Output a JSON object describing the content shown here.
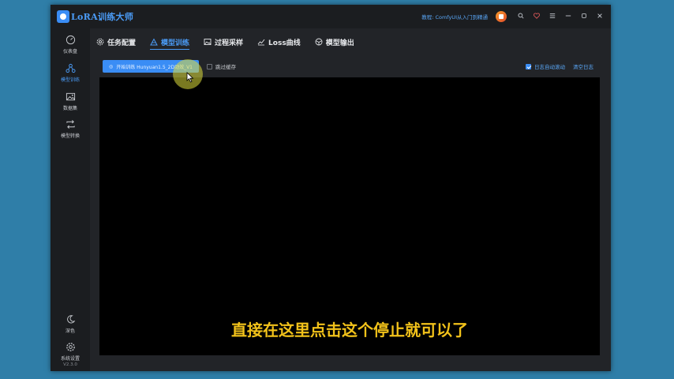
{
  "app": {
    "logo_text": "LoRA训练大师",
    "tutorial_link": "教程: ComfyUI从入门到精通"
  },
  "titlebar_icons": [
    "search-icon",
    "heart-icon",
    "menu-icon",
    "minimize-icon",
    "maximize-icon",
    "close-icon"
  ],
  "sidebar": {
    "items": [
      {
        "label": "仪表盘",
        "icon": "gauge-icon"
      },
      {
        "label": "模型训练",
        "icon": "train-icon",
        "active": true
      },
      {
        "label": "数据集",
        "icon": "image-icon"
      },
      {
        "label": "模型转换",
        "icon": "convert-icon"
      }
    ],
    "theme_label": "深色",
    "settings_label": "系统设置",
    "version": "V2.3.0"
  },
  "tabs": [
    {
      "label": "任务配置",
      "icon": "gear-icon"
    },
    {
      "label": "模型训练",
      "icon": "train-icon",
      "active": true
    },
    {
      "label": "过程采样",
      "icon": "image-icon"
    },
    {
      "label": "Loss曲线",
      "icon": "chart-icon"
    },
    {
      "label": "模型输出",
      "icon": "box-icon"
    }
  ],
  "toolbar": {
    "start_button": "开始训练 Hunyuan1.5_2D动效_V1",
    "skip_cache": "跳过缓存",
    "autoscroll": "日志自动滚动",
    "clear_log": "清空日志"
  },
  "subtitle": "直接在这里点击这个停止就可以了",
  "colors": {
    "accent": "#3a8df5",
    "subtitle": "#f2c21a",
    "background": "#2f7ea8"
  }
}
